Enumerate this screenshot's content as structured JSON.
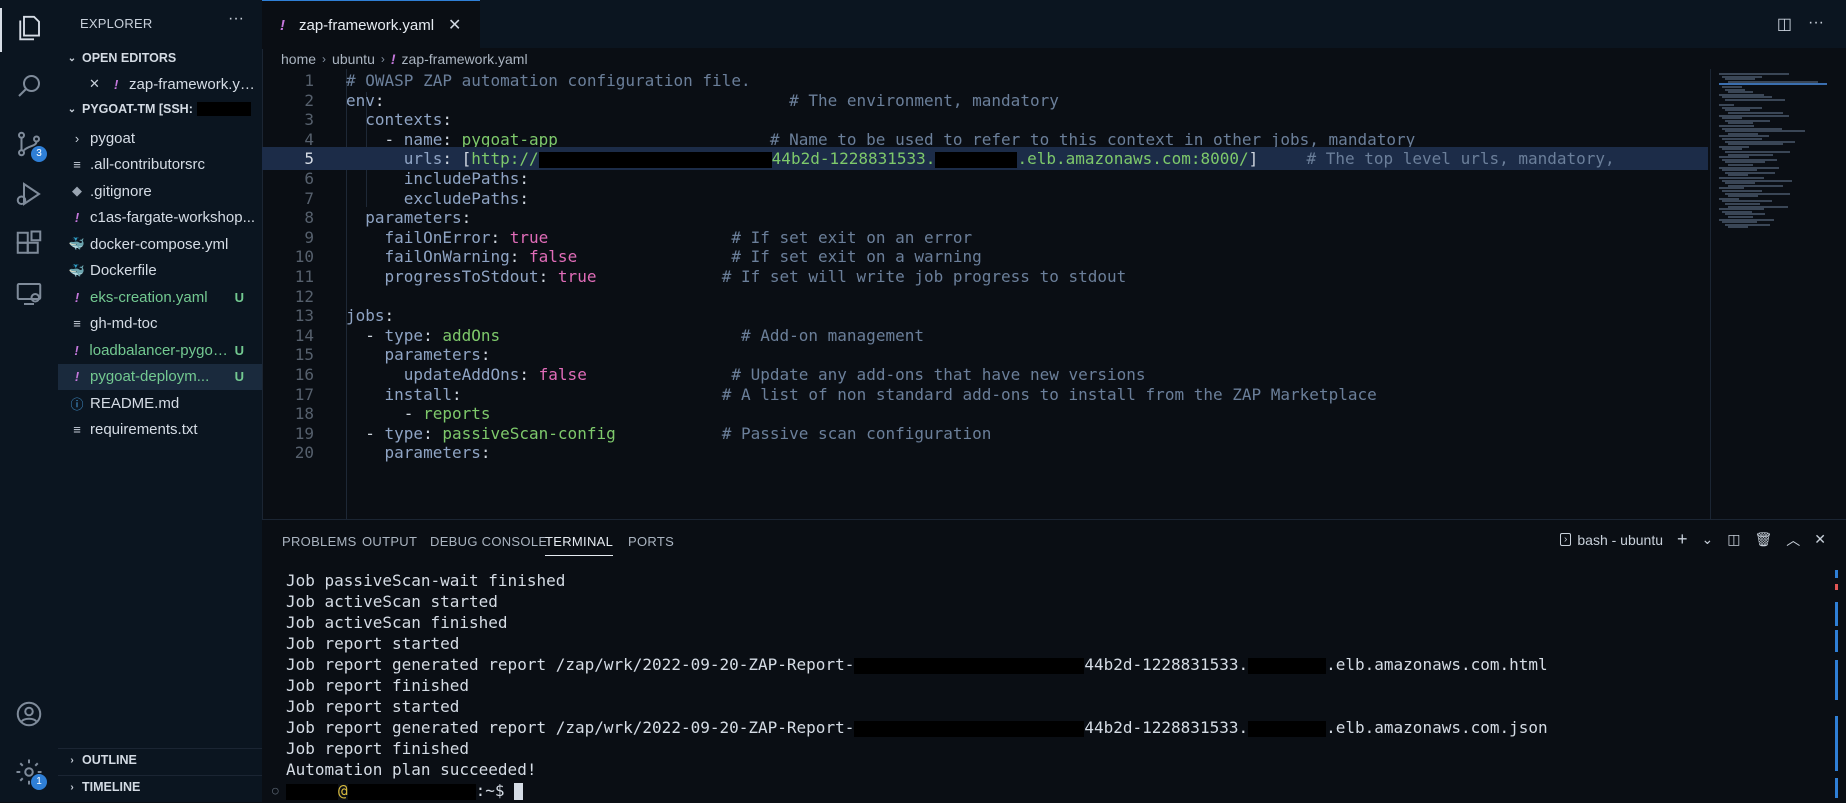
{
  "activity_bar": {
    "source_control_badge": "3",
    "settings_badge": "1"
  },
  "sidebar": {
    "title": "EXPLORER",
    "more": "···",
    "open_editors_header": "OPEN EDITORS",
    "open_editor_file": "zap-framework.yaml",
    "workspace_header": "PYGOAT-TM [SSH:",
    "files": [
      {
        "label": "pygoat",
        "icon": "chevron-right",
        "status": ""
      },
      {
        "label": ".all-contributorsrc",
        "icon": "lines",
        "status": ""
      },
      {
        "label": ".gitignore",
        "icon": "diamond",
        "status": ""
      },
      {
        "label": "c1as-fargate-workshop...",
        "icon": "yaml",
        "status": ""
      },
      {
        "label": "docker-compose.yml",
        "icon": "docker",
        "status": ""
      },
      {
        "label": "Dockerfile",
        "icon": "docker",
        "status": ""
      },
      {
        "label": "eks-creation.yaml",
        "icon": "yaml",
        "status": "U"
      },
      {
        "label": "gh-md-toc",
        "icon": "lines",
        "status": ""
      },
      {
        "label": "loadbalancer-pygoat...",
        "icon": "yaml",
        "status": "U"
      },
      {
        "label": "pygoat-deploym...",
        "icon": "yaml",
        "status": "U"
      },
      {
        "label": "README.md",
        "icon": "info",
        "status": ""
      },
      {
        "label": "requirements.txt",
        "icon": "lines",
        "status": ""
      }
    ],
    "outline_header": "OUTLINE",
    "timeline_header": "TIMELINE"
  },
  "editor": {
    "tab_label": "zap-framework.yaml",
    "breadcrumb": [
      "home",
      "ubuntu",
      "zap-framework.yaml"
    ],
    "lines": [
      {
        "n": "1",
        "indent": "",
        "parts": [
          [
            "c",
            "# OWASP ZAP automation configuration file."
          ]
        ]
      },
      {
        "n": "2",
        "indent": "",
        "parts": [
          [
            "k",
            "env"
          ],
          [
            "p",
            ":"
          ],
          [
            "p",
            "                                          "
          ],
          [
            "c",
            "# The environment, mandatory"
          ]
        ]
      },
      {
        "n": "3",
        "indent": "  ",
        "parts": [
          [
            "k",
            "contexts"
          ],
          [
            "p",
            ":"
          ]
        ]
      },
      {
        "n": "4",
        "indent": "    ",
        "parts": [
          [
            "p",
            "- "
          ],
          [
            "k",
            "name"
          ],
          [
            "p",
            ": "
          ],
          [
            "s",
            "pygoat-app"
          ],
          [
            "p",
            "                      "
          ],
          [
            "c",
            "# Name to be used to refer to this context in other jobs, mandatory"
          ]
        ]
      },
      {
        "n": "5",
        "indent": "      ",
        "parts": [
          [
            "k",
            "urls"
          ],
          [
            "p",
            ": ["
          ],
          [
            "s",
            "http://"
          ],
          [
            "redact",
            ""
          ],
          [
            "s",
            "44b2d-1228831533."
          ],
          [
            "redact2",
            ""
          ],
          [
            "s",
            ".elb.amazonaws.com:8000/"
          ],
          [
            "p",
            "]"
          ],
          [
            "p",
            "     "
          ],
          [
            "c",
            "# The top level urls, mandatory,"
          ]
        ]
      },
      {
        "n": "6",
        "indent": "      ",
        "parts": [
          [
            "k",
            "includePaths"
          ],
          [
            "p",
            ":"
          ]
        ]
      },
      {
        "n": "7",
        "indent": "      ",
        "parts": [
          [
            "k",
            "excludePaths"
          ],
          [
            "p",
            ":"
          ]
        ]
      },
      {
        "n": "8",
        "indent": "  ",
        "parts": [
          [
            "k",
            "parameters"
          ],
          [
            "p",
            ":"
          ]
        ]
      },
      {
        "n": "9",
        "indent": "    ",
        "parts": [
          [
            "k",
            "failOnError"
          ],
          [
            "p",
            ": "
          ],
          [
            "b",
            "true"
          ],
          [
            "p",
            "                   "
          ],
          [
            "c",
            "# If set exit on an error"
          ]
        ]
      },
      {
        "n": "10",
        "indent": "    ",
        "parts": [
          [
            "k",
            "failOnWarning"
          ],
          [
            "p",
            ": "
          ],
          [
            "b",
            "false"
          ],
          [
            "p",
            "                "
          ],
          [
            "c",
            "# If set exit on a warning"
          ]
        ]
      },
      {
        "n": "11",
        "indent": "    ",
        "parts": [
          [
            "k",
            "progressToStdout"
          ],
          [
            "p",
            ": "
          ],
          [
            "b",
            "true"
          ],
          [
            "p",
            "             "
          ],
          [
            "c",
            "# If set will write job progress to stdout"
          ]
        ]
      },
      {
        "n": "12",
        "indent": "",
        "parts": []
      },
      {
        "n": "13",
        "indent": "",
        "parts": [
          [
            "k",
            "jobs"
          ],
          [
            "p",
            ":"
          ]
        ]
      },
      {
        "n": "14",
        "indent": "  ",
        "parts": [
          [
            "p",
            "- "
          ],
          [
            "k",
            "type"
          ],
          [
            "p",
            ": "
          ],
          [
            "s",
            "addOns"
          ],
          [
            "p",
            "                         "
          ],
          [
            "c",
            "# Add-on management"
          ]
        ]
      },
      {
        "n": "15",
        "indent": "    ",
        "parts": [
          [
            "k",
            "parameters"
          ],
          [
            "p",
            ":"
          ]
        ]
      },
      {
        "n": "16",
        "indent": "      ",
        "parts": [
          [
            "k",
            "updateAddOns"
          ],
          [
            "p",
            ": "
          ],
          [
            "b",
            "false"
          ],
          [
            "p",
            "               "
          ],
          [
            "c",
            "# Update any add-ons that have new versions"
          ]
        ]
      },
      {
        "n": "17",
        "indent": "    ",
        "parts": [
          [
            "k",
            "install"
          ],
          [
            "p",
            ":"
          ],
          [
            "p",
            "                           "
          ],
          [
            "c",
            "# A list of non standard add-ons to install from the ZAP Marketplace"
          ]
        ]
      },
      {
        "n": "18",
        "indent": "      ",
        "parts": [
          [
            "p",
            "- "
          ],
          [
            "s",
            "reports"
          ]
        ]
      },
      {
        "n": "19",
        "indent": "  ",
        "parts": [
          [
            "p",
            "- "
          ],
          [
            "k",
            "type"
          ],
          [
            "p",
            ": "
          ],
          [
            "s",
            "passiveScan-config"
          ],
          [
            "p",
            "           "
          ],
          [
            "c",
            "# Passive scan configuration"
          ]
        ]
      },
      {
        "n": "20",
        "indent": "    ",
        "parts": [
          [
            "k",
            "parameters"
          ],
          [
            "p",
            ":"
          ]
        ]
      }
    ]
  },
  "panel": {
    "tabs": [
      "PROBLEMS",
      "OUTPUT",
      "DEBUG CONSOLE",
      "TERMINAL",
      "PORTS"
    ],
    "active_tab": "TERMINAL",
    "terminal_name": "bash - ubuntu",
    "terminal_lines": [
      "Job passiveScan-wait finished",
      "Job activeScan started",
      "Job activeScan finished",
      "Job report started",
      "Job report generated report /zap/wrk/2022-09-20-ZAP-Report-",
      "Job report finished",
      "Job report started",
      "Job report generated report /zap/wrk/2022-09-20-ZAP-Report-",
      "Job report finished",
      "Automation plan succeeded!"
    ],
    "report_suffix_mid": "44b2d-1228831533.",
    "report_suffix_html": ".elb.amazonaws.com.html",
    "report_suffix_json": ".elb.amazonaws.com.json",
    "prompt_at": "@",
    "prompt_tail": ":~$ "
  }
}
